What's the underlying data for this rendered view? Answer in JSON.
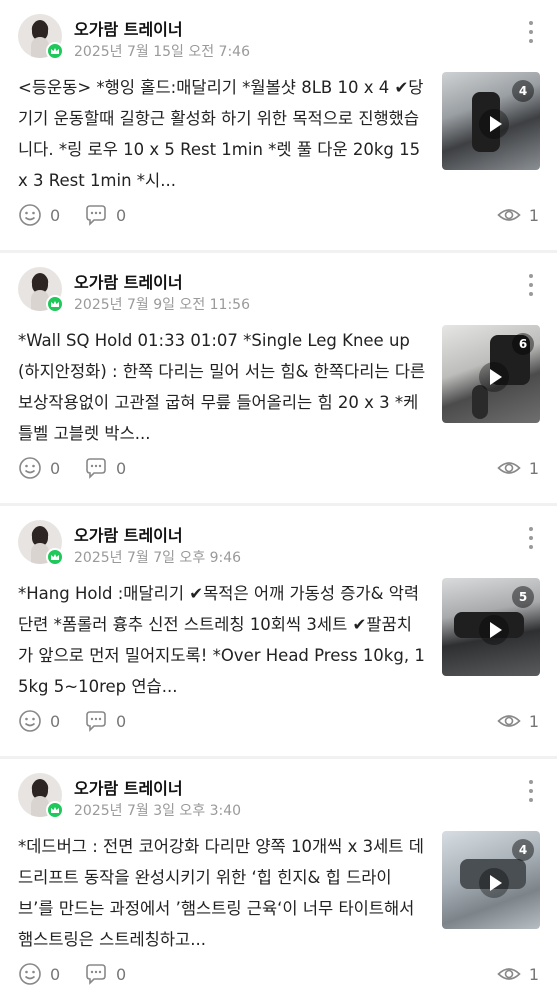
{
  "posts": [
    {
      "author": "오가람 트레이너",
      "date": "2025년 7월 15일 오전 7:46",
      "text": "<등운동> *행잉 홀드:매달리기 *월볼샷  8LB 10 x 4  ✔당기기 운동할때 길항근 활성화 하기 위한 목적으로 진행했습니다. *링 로우  10 x 5  Rest 1min *렛 풀 다운 20kg 15 x 3  Rest 1min *시...",
      "media_count": "4",
      "likes": "0",
      "comments": "0",
      "views": "1"
    },
    {
      "author": "오가람 트레이너",
      "date": "2025년 7월 9일 오전 11:56",
      "text": "*Wall SQ Hold  01:33 01:07 *Single Leg Knee up (하지안정화) : 한쪽 다리는 밀어 서는 힘& 한쪽다리는 다른 보상작용없이 고관절 굽혀 무릎 들어올리는 힘 20 x 3  *케틀벨 고블렛 박스...",
      "media_count": "6",
      "likes": "0",
      "comments": "0",
      "views": "1"
    },
    {
      "author": "오가람 트레이너",
      "date": "2025년 7월 7일 오후 9:46",
      "text": "*Hang Hold :매달리기 ✔목적은 어깨 가동성 증가& 악력단련 *폼롤러 흉추 신전 스트레칭 10회씩 3세트 ✔팔꿈치가 앞으로 먼저 밀어지도록! *Over Head Press  10kg, 15kg  5~10rep 연습...",
      "media_count": "5",
      "likes": "0",
      "comments": "0",
      "views": "1"
    },
    {
      "author": "오가람 트레이너",
      "date": "2025년 7월 3일 오후 3:40",
      "text": "*데드버그 : 전면 코어강화 다리만 양쪽 10개씩  x 3세트 데드리프트 동작을 완성시키기 위한 ‘힙 힌지& 힙 드라이브’를  만드는 과정에서 ’햄스트링 근육‘이 너무 타이트해서 햄스트링은 스트레칭하고...",
      "media_count": "4",
      "likes": "0",
      "comments": "0",
      "views": "1"
    }
  ],
  "colors": {
    "badge": "#1ec85a",
    "meta_text": "#9a9a9a",
    "divider": "#f1f1f1"
  },
  "icons": {
    "badge": "crown-icon",
    "more": "more-vertical-icon",
    "likes": "smiley-icon",
    "comments": "comment-bubble-icon",
    "views": "eye-icon",
    "play": "play-icon"
  }
}
